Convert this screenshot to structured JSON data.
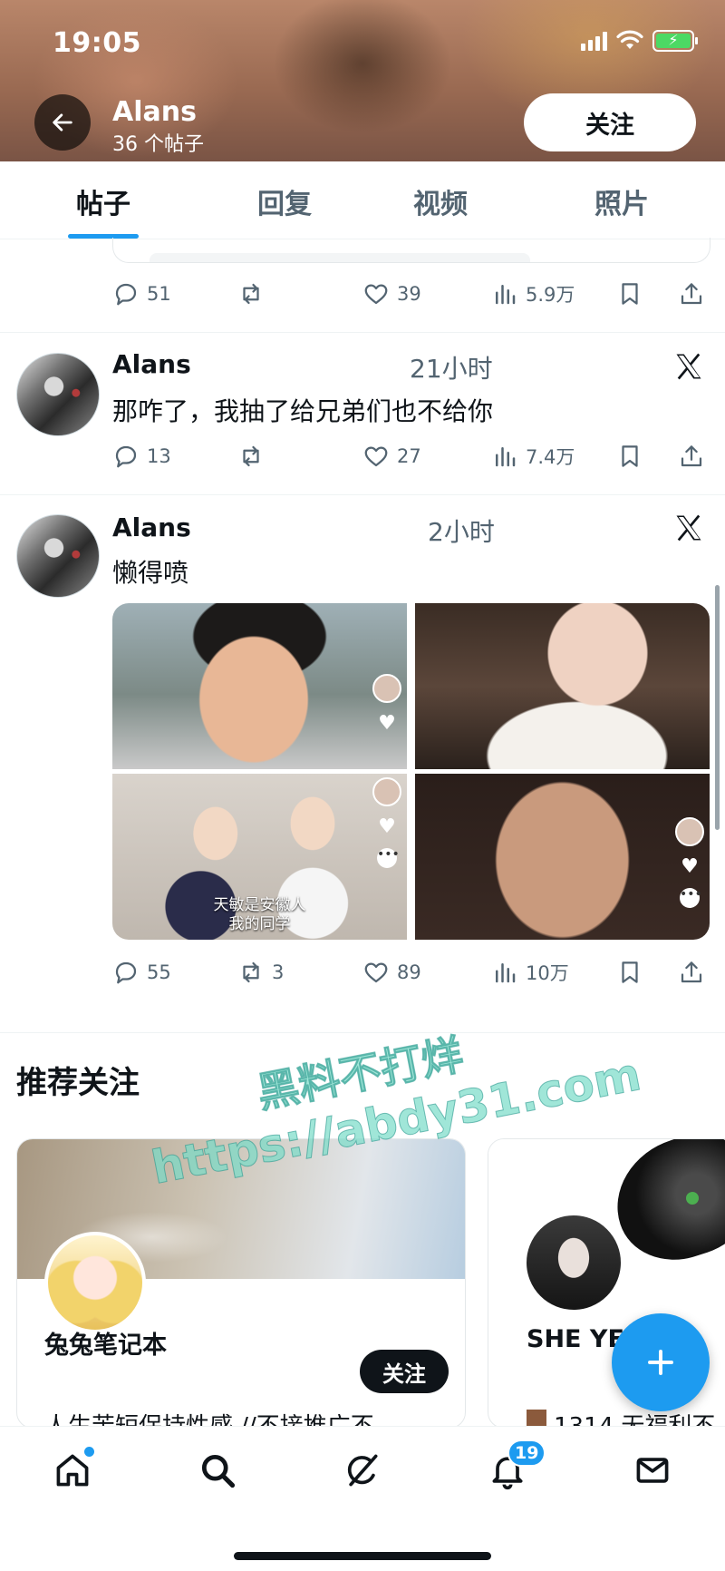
{
  "status_bar": {
    "time": "19:05"
  },
  "profile": {
    "name": "Alans",
    "post_count": "36 个帖子",
    "follow_label": "关注"
  },
  "tabs": [
    {
      "label": "帖子",
      "active": true
    },
    {
      "label": "回复"
    },
    {
      "label": "视频"
    },
    {
      "label": "照片"
    }
  ],
  "posts": [
    {
      "author": "",
      "time": "",
      "text": "",
      "stats": {
        "replies": "51",
        "reposts": "",
        "likes": "39",
        "views": "5.9万"
      }
    },
    {
      "author": "Alans",
      "time": "21小时",
      "text": "那咋了，我抽了给兄弟们也不给你",
      "stats": {
        "replies": "13",
        "reposts": "",
        "likes": "27",
        "views": "7.4万"
      }
    },
    {
      "author": "Alans",
      "time": "2小时",
      "text": "懒得喷",
      "media_caption": [
        "天敏是安徽人",
        "我的同学"
      ],
      "stats": {
        "replies": "55",
        "reposts": "3",
        "likes": "89",
        "views": "10万"
      }
    }
  ],
  "recommended": {
    "title": "推荐关注",
    "cards": [
      {
        "name": "兔兔笔记本",
        "follow_label": "关注",
        "bio": "人生苦短保持性感 //不接推广不"
      },
      {
        "name": "SHE YE",
        "bio": "1314 无福利不"
      }
    ]
  },
  "watermark": {
    "line1": "黑料不打烊",
    "line2": "https://abdy31.com"
  },
  "bottom_nav": {
    "notifications_badge": "19"
  },
  "icons": [
    "back-arrow-icon",
    "x-logo-icon",
    "reply-icon",
    "repost-icon",
    "like-icon",
    "views-icon",
    "bookmark-icon",
    "share-icon",
    "home-icon",
    "search-icon",
    "grok-icon",
    "bell-icon",
    "mail-icon",
    "plus-icon"
  ],
  "colors": {
    "accent": "#1d9bf0",
    "text": "#0f1419",
    "muted": "#536471"
  }
}
